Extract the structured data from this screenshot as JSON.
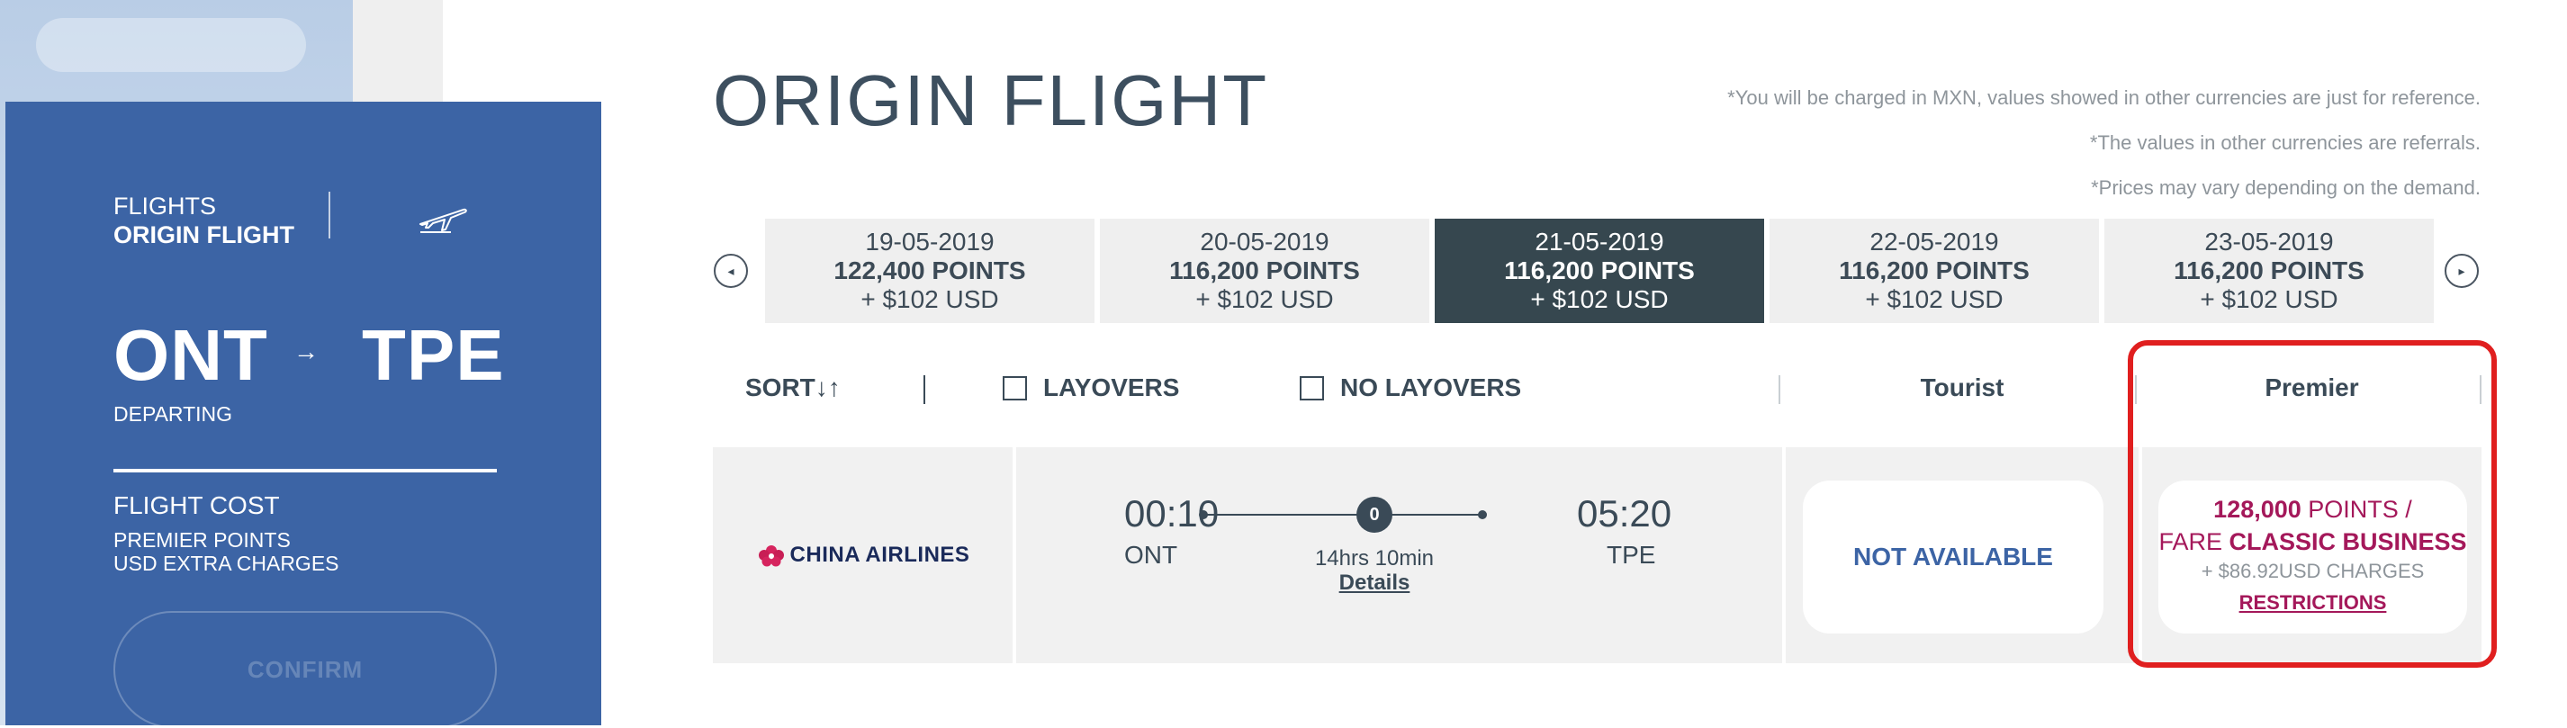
{
  "colors": {
    "card_blue": "#3c64a5",
    "active_date": "#36474f",
    "premium_magenta": "#a4185a",
    "highlight_red": "#e01f1f"
  },
  "summary": {
    "flights_label": "FLIGHTS",
    "origin_label": "ORIGIN FLIGHT",
    "plane_icon": "airplane-takeoff-icon",
    "from": "ONT",
    "to": "TPE",
    "arrow": "→",
    "departing": "DEPARTING",
    "cost_title": "FLIGHT COST",
    "cost_line1": "PREMIER POINTS",
    "cost_line2": "USD EXTRA CHARGES",
    "confirm_label": "CONFIRM"
  },
  "header": {
    "title": "ORIGIN FLIGHT",
    "notes": [
      "*You will be charged in MXN, values showed in other currencies are just for reference.",
      "*The values in other currencies are referrals.",
      "*Prices may vary depending on the demand."
    ]
  },
  "dates": [
    {
      "date": "19-05-2019",
      "points": "122,400 POINTS",
      "usd": "+ $102 USD",
      "active": false
    },
    {
      "date": "20-05-2019",
      "points": "116,200 POINTS",
      "usd": "+ $102 USD",
      "active": false
    },
    {
      "date": "21-05-2019",
      "points": "116,200 POINTS",
      "usd": "+ $102 USD",
      "active": true
    },
    {
      "date": "22-05-2019",
      "points": "116,200 POINTS",
      "usd": "+ $102 USD",
      "active": false
    },
    {
      "date": "23-05-2019",
      "points": "116,200 POINTS",
      "usd": "+ $102 USD",
      "active": false
    }
  ],
  "nav": {
    "prev": "◂",
    "next": "▸"
  },
  "filters": {
    "sort_label": "SORT↓↑",
    "layovers_label": "LAYOVERS",
    "no_layovers_label": "NO LAYOVERS",
    "col_tourist": "Tourist",
    "col_premier": "Premier"
  },
  "flight": {
    "airline": "CHINA AIRLINES",
    "dep_time": "00:10",
    "dep_city": "ONT",
    "arr_time": "05:20",
    "arr_city": "TPE",
    "stops": "0",
    "duration": "14hrs 10min",
    "details_label": "Details",
    "tourist_status": "NOT AVAILABLE",
    "premier_points": "128,000",
    "premier_points_suffix": " POINTS /",
    "premier_fare_prefix": "FARE ",
    "premier_fare_name": "CLASSIC BUSINESS",
    "premier_charges": "+ $86.92USD CHARGES",
    "restrictions_label": "RESTRICTIONS"
  }
}
